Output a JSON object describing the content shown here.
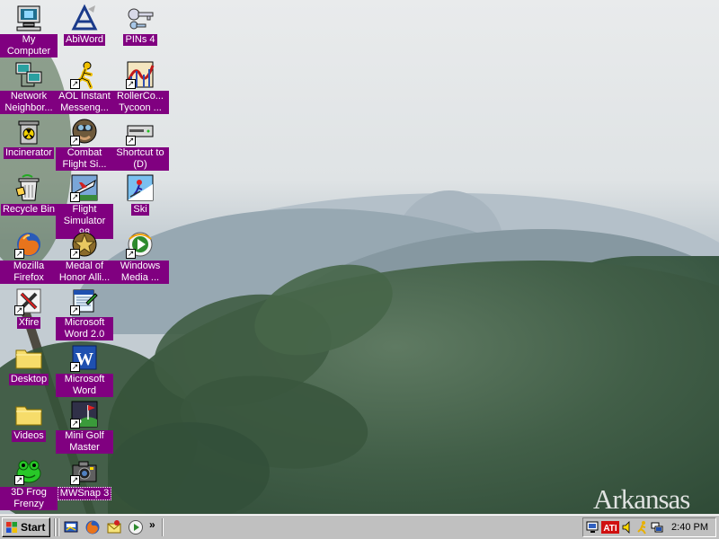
{
  "desktop": {
    "watermark": "Arkansas",
    "icons": [
      {
        "id": "my-computer",
        "label": "My Computer",
        "icon": "computer-icon",
        "shortcut": false
      },
      {
        "id": "abiword",
        "label": "AbiWord",
        "icon": "abiword-icon",
        "shortcut": false
      },
      {
        "id": "pins4",
        "label": "PINs 4",
        "icon": "key-icon",
        "shortcut": false
      },
      {
        "id": "network-neighborhood",
        "label": "Network Neighbor...",
        "icon": "network-icon",
        "shortcut": false
      },
      {
        "id": "aol-instant-messenger",
        "label": "AOL Instant Messeng...",
        "icon": "aim-runner-icon",
        "shortcut": true
      },
      {
        "id": "rollercoaster-tycoon",
        "label": "RollerCo... Tycoon ...",
        "icon": "rollercoaster-icon",
        "shortcut": true
      },
      {
        "id": "incinerator",
        "label": "Incinerator",
        "icon": "incinerator-icon",
        "shortcut": false
      },
      {
        "id": "combat-flight-sim",
        "label": "Combat Flight Si...",
        "icon": "pilot-icon",
        "shortcut": true
      },
      {
        "id": "shortcut-to-d",
        "label": "Shortcut to (D)",
        "icon": "drive-icon",
        "shortcut": true
      },
      {
        "id": "recycle-bin",
        "label": "Recycle Bin",
        "icon": "recycle-bin-icon",
        "shortcut": false
      },
      {
        "id": "flight-simulator-98",
        "label": "Flight Simulator 98",
        "icon": "airplane-icon",
        "shortcut": true
      },
      {
        "id": "ski",
        "label": "Ski",
        "icon": "ski-icon",
        "shortcut": false
      },
      {
        "id": "mozilla-firefox",
        "label": "Mozilla Firefox",
        "icon": "firefox-icon",
        "shortcut": true
      },
      {
        "id": "medal-of-honor",
        "label": "Medal of Honor Alli...",
        "icon": "medal-icon",
        "shortcut": true
      },
      {
        "id": "windows-media",
        "label": "Windows Media ...",
        "icon": "media-player-icon",
        "shortcut": true
      },
      {
        "id": "xfire",
        "label": "Xfire",
        "icon": "xfire-icon",
        "shortcut": true
      },
      {
        "id": "microsoft-word-2",
        "label": "Microsoft Word 2.0",
        "icon": "word-classic-icon",
        "shortcut": true
      },
      {
        "id": "desktop-folder",
        "label": "Desktop",
        "icon": "folder-icon",
        "shortcut": false
      },
      {
        "id": "microsoft-word",
        "label": "Microsoft Word",
        "icon": "word-icon",
        "shortcut": true
      },
      {
        "id": "videos-folder",
        "label": "Videos",
        "icon": "folder-icon",
        "shortcut": false
      },
      {
        "id": "mini-golf-master",
        "label": "Mini Golf Master",
        "icon": "golf-icon",
        "shortcut": true
      },
      {
        "id": "3d-frog-frenzy",
        "label": "3D Frog Frenzy",
        "icon": "frog-icon",
        "shortcut": true
      },
      {
        "id": "mwsnap3",
        "label": "MWSnap 3",
        "icon": "camera-icon",
        "shortcut": true,
        "selected": true
      }
    ]
  },
  "taskbar": {
    "start_label": "Start",
    "quick_launch": [
      {
        "id": "show-desktop",
        "icon": "show-desktop-icon"
      },
      {
        "id": "firefox",
        "icon": "firefox-icon"
      },
      {
        "id": "outlook-express",
        "icon": "mail-icon"
      },
      {
        "id": "media-player",
        "icon": "media-player-icon"
      }
    ],
    "more_label": "»",
    "tray": {
      "icons": [
        "monitor-icon",
        "ati-icon",
        "volume-icon",
        "runner-icon",
        "network-icon"
      ],
      "ati_label": "ATI",
      "clock": "2:40 PM"
    }
  },
  "colors": {
    "label_background": "#800080",
    "label_text": "#ffffff",
    "taskbar": "#c0c0c0"
  }
}
